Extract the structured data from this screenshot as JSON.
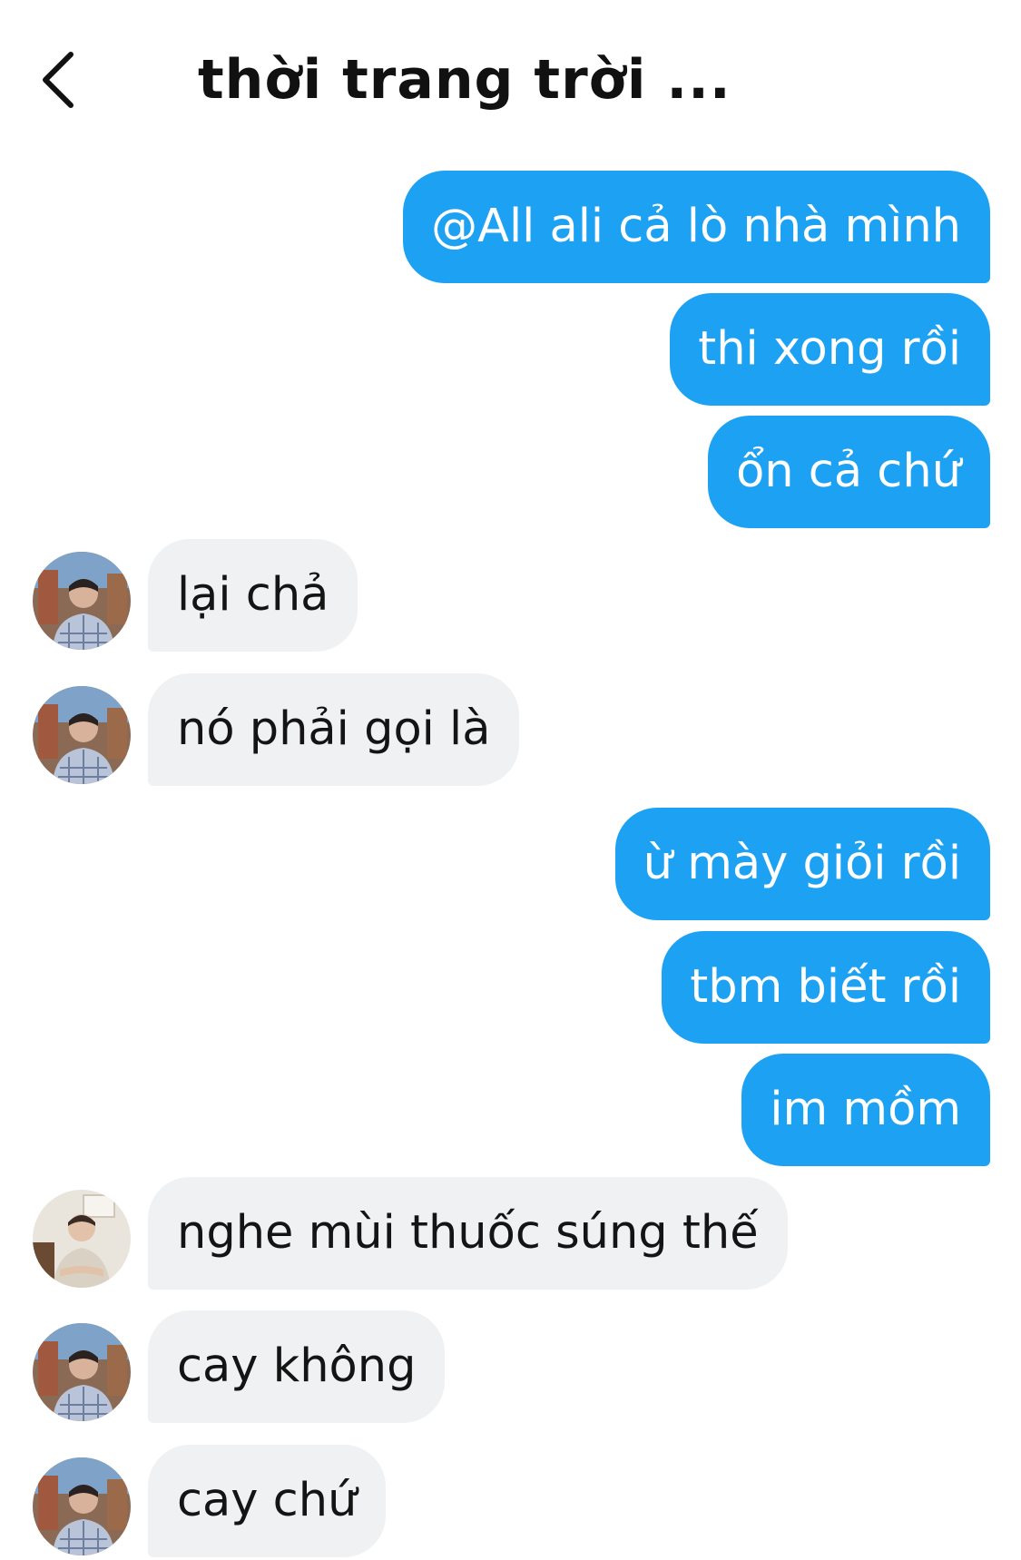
{
  "header": {
    "title": "thời trang trời ...",
    "back_icon": "chevron-left-icon"
  },
  "colors": {
    "outgoing_bubble": "#1da1f2",
    "incoming_bubble": "#eff1f3",
    "outgoing_text": "#ffffff",
    "incoming_text": "#141414"
  },
  "messages": [
    {
      "direction": "out",
      "text": "@All ali cả lò nhà mình"
    },
    {
      "direction": "out",
      "text": "thi xong rồi"
    },
    {
      "direction": "out",
      "text": "ổn cả chứ"
    },
    {
      "direction": "in",
      "avatar": "avatar-1",
      "text": "lại chả"
    },
    {
      "direction": "in",
      "avatar": "avatar-1",
      "text": "nó phải gọi là"
    },
    {
      "direction": "out",
      "text": "ừ mày giỏi rồi"
    },
    {
      "direction": "out",
      "text": "tbm biết rồi"
    },
    {
      "direction": "out",
      "text": "im mồm"
    },
    {
      "direction": "in",
      "avatar": "avatar-2",
      "text": "nghe mùi thuốc súng thế"
    },
    {
      "direction": "in",
      "avatar": "avatar-1",
      "text": "cay không"
    },
    {
      "direction": "in",
      "avatar": "avatar-1",
      "text": "cay chứ"
    }
  ]
}
